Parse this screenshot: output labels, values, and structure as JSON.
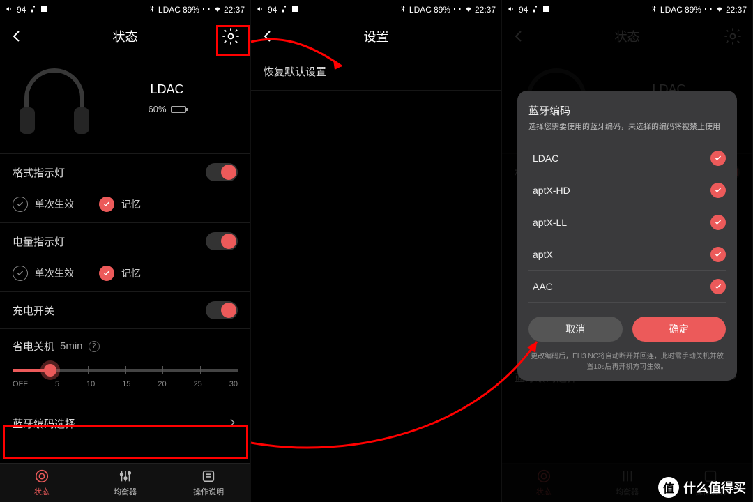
{
  "statusbar": {
    "vol": "94",
    "codec": "LDAC",
    "batt_pct": "89%",
    "time": "22:37"
  },
  "screen1": {
    "title": "状态",
    "codec": "LDAC",
    "batt_pct_text": "60%",
    "format_led": "格式指示灯",
    "once": "单次生效",
    "memory": "记忆",
    "power_led": "电量指示灯",
    "charge_switch": "充电开关",
    "power_save": "省电关机",
    "power_save_val": "5min",
    "ticks": {
      "t0": "OFF",
      "t1": "5",
      "t2": "10",
      "t3": "15",
      "t4": "20",
      "t5": "25",
      "t6": "30"
    },
    "bt_codec_select": "蓝牙编码选择",
    "tabs": {
      "status": "状态",
      "eq": "均衡器",
      "manual": "操作说明"
    }
  },
  "screen2": {
    "title": "设置",
    "restore": "恢复默认设置"
  },
  "screen3": {
    "dialog_title": "蓝牙编码",
    "dialog_sub": "选择您需要使用的蓝牙编码，未选择的编码将被禁止使用",
    "opts": {
      "o0": "LDAC",
      "o1": "aptX-HD",
      "o2": "aptX-LL",
      "o3": "aptX",
      "o4": "AAC"
    },
    "cancel": "取消",
    "ok": "确定",
    "note": "更改编码后，EH3 NC将自动断开并回连，此时需手动关机并放置10s后再开机方可生效。",
    "bt_codec_select": "蓝牙编码选择"
  },
  "watermark": {
    "badge": "值",
    "text": "什么值得买"
  }
}
